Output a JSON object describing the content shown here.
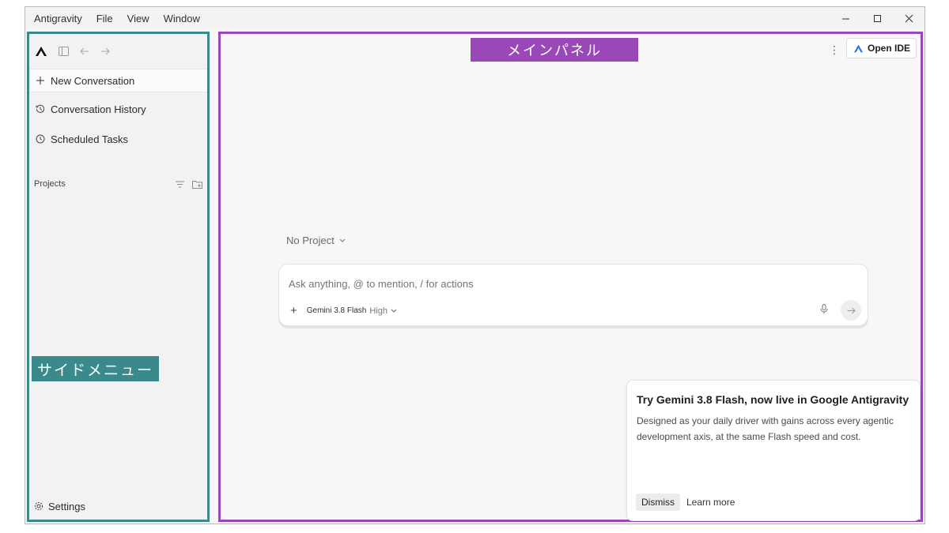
{
  "menu": [
    "Antigravity",
    "File",
    "View",
    "Window"
  ],
  "sidebar": {
    "nav": [
      {
        "icon": "plus-icon",
        "label": "New Conversation"
      },
      {
        "icon": "history-icon",
        "label": "Conversation History"
      },
      {
        "icon": "clock-icon",
        "label": "Scheduled Tasks"
      }
    ],
    "projects_label": "Projects",
    "settings_label": "Settings",
    "annotation": "サイドメニュー"
  },
  "main": {
    "annotation": "メインパネル",
    "open_ide_label": "Open IDE",
    "project_select": "No Project",
    "composer": {
      "placeholder": "Ask anything, @ to mention, / for actions",
      "model": "Gemini 3.8 Flash",
      "level": "High"
    },
    "toast": {
      "title": "Try Gemini 3.8 Flash, now live in Google Antigravity",
      "body": "Designed as your daily driver with gains across every agentic development axis, at the same Flash speed and cost.",
      "dismiss_label": "Dismiss",
      "learn_label": "Learn more"
    }
  },
  "colors": {
    "sidebar_accent": "#3a8a8c",
    "main_accent": "#9a48b8",
    "brand_logo": "#1a73e8"
  }
}
